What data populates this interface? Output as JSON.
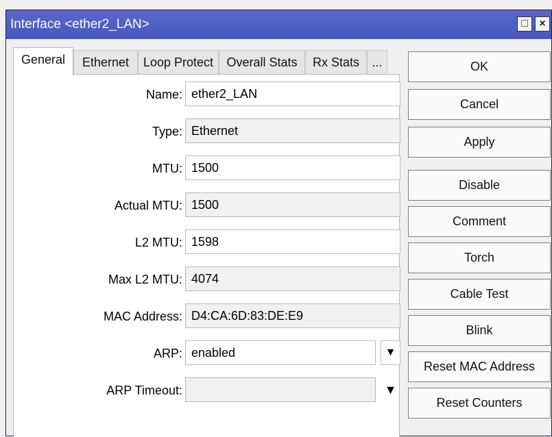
{
  "window": {
    "title": "Interface <ether2_LAN>",
    "restore_glyph": "□",
    "close_glyph": "×"
  },
  "tabs": [
    {
      "label": "General",
      "active": true
    },
    {
      "label": "Ethernet"
    },
    {
      "label": "Loop Protect"
    },
    {
      "label": "Overall Stats"
    },
    {
      "label": "Rx Stats"
    },
    {
      "label": "..."
    }
  ],
  "fields": [
    {
      "label": "Name:",
      "value": "ether2_LAN",
      "editable": true
    },
    {
      "label": "Type:",
      "value": "Ethernet",
      "editable": false
    },
    {
      "label": "MTU:",
      "value": "1500",
      "editable": true
    },
    {
      "label": "Actual MTU:",
      "value": "1500",
      "editable": false
    },
    {
      "label": "L2 MTU:",
      "value": "1598",
      "editable": true
    },
    {
      "label": "Max L2 MTU:",
      "value": "4074",
      "editable": false
    },
    {
      "label": "MAC Address:",
      "value": "D4:CA:6D:83:DE:E9",
      "editable": false
    },
    {
      "label": "ARP:",
      "value": "enabled",
      "editable": true
    },
    {
      "label": "ARP Timeout:",
      "value": "",
      "editable": true
    }
  ],
  "buttons": [
    "OK",
    "Cancel",
    "Apply",
    "Disable",
    "Comment",
    "Torch",
    "Cable Test",
    "Blink",
    "Reset MAC Address",
    "Reset Counters"
  ],
  "icons": {
    "arp_dropdown": "▼",
    "arp_timeout_dropdown": "▼"
  }
}
